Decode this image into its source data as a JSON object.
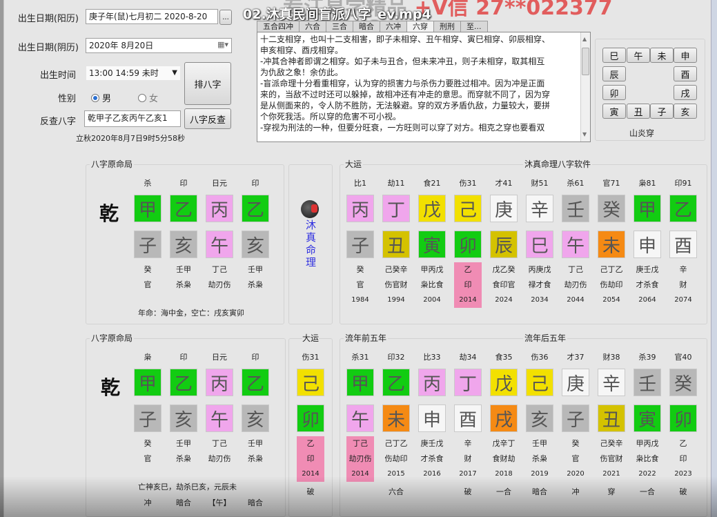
{
  "video": {
    "title": "02.沐真民间盲派八字_ev.mp4",
    "watermark_gray": "专江易学精品",
    "watermark_red": "+V信 27**022377"
  },
  "form": {
    "birth_date_solar_label": "出生日期(阳历)",
    "birth_date_solar_value": "庚子年(鼠)七月初二 2020-8-20",
    "browse_button": "...",
    "birth_date_lunar_label": "出生日期(阴历)",
    "birth_date_lunar_value": "2020年 8月20日",
    "birth_time_label": "出生时间",
    "birth_time_value": "13:00 14:59 未时",
    "gender_label": "性别",
    "gender_options": [
      "男",
      "女"
    ],
    "gender_selected": "男",
    "reverse_label": "反查八字",
    "reverse_value": "乾甲子乙亥丙午乙亥1",
    "paipan_button": "排八字",
    "reverse_button": "八字反查",
    "solar_term_note": "立秋2020年8月7日9时5分58秒"
  },
  "relation_tabs": {
    "items": [
      "五合四冲",
      "六合",
      "三合",
      "暗合",
      "六冲",
      "六穿",
      "刑刑",
      "至..."
    ],
    "active": "六穿"
  },
  "relation_text": {
    "lines": [
      "十二支相穿，也叫十二支相害，即子未相穿、丑午相穿、寅巳相穿、卯辰相穿、",
      "申亥相穿、酉戌相穿。",
      " -冲其合神者即谓之相穿。如子未与丑合，但未来冲丑，则子未相穿，取其相互",
      "为仇敌之象！余仿此。",
      " -盲派命理十分看重相穿，认为穿的损害力与杀伤力要胜过相冲。因为冲是正面",
      "来的，当敌不过时还可以躲掉，故相冲还有冲走的意思。而穿就不同了，因为穿",
      "是从侧面来的，令人防不胜防，无法躲避。穿的双方矛盾仇敌，力量较大，要拼",
      "个你死我活。所以穿的危害不可小视。",
      " -穿视为刑法的一种，但要分旺衰，一方旺则可以穿了对方。相克之穿也要看双"
    ]
  },
  "branch_panel": {
    "top": [
      "巳",
      "午",
      "未",
      "申"
    ],
    "left": [
      "辰",
      "卯"
    ],
    "right": [
      "酉",
      "戌"
    ],
    "bottom": [
      "寅",
      "丑",
      "子",
      "亥"
    ],
    "caption": "山炎穿"
  },
  "natal_chart_1": {
    "title": "八字原命局",
    "gender_char": "乾",
    "ten_gods": [
      "杀",
      "印",
      "日元",
      "印"
    ],
    "stems": [
      {
        "char": "甲",
        "color": "green"
      },
      {
        "char": "乙",
        "color": "green"
      },
      {
        "char": "丙",
        "color": "pink"
      },
      {
        "char": "乙",
        "color": "green"
      }
    ],
    "branches": [
      {
        "char": "子",
        "color": "gray"
      },
      {
        "char": "亥",
        "color": "gray"
      },
      {
        "char": "午",
        "color": "pink"
      },
      {
        "char": "亥",
        "color": "gray"
      }
    ],
    "hidden_stems": [
      "癸",
      "壬甲",
      "丁己",
      "壬甲"
    ],
    "hidden_gods": [
      "官",
      "杀枭",
      "劫刃伤",
      "杀枭"
    ],
    "footer": "年命：海中金，空亡：戌亥寅卯"
  },
  "logo": {
    "text": "沐真命理"
  },
  "dayun": {
    "title": "大运",
    "software_title": "沐真命理八字软件",
    "columns": [
      {
        "god": "比1",
        "stem": "丙",
        "stem_color": "pink",
        "branch": "子",
        "branch_color": "gray",
        "hidden": "癸",
        "hidden_god": "官",
        "year": "1984"
      },
      {
        "god": "劫11",
        "stem": "丁",
        "stem_color": "pink",
        "branch": "丑",
        "branch_color": "olive",
        "hidden": "己癸辛",
        "hidden_god": "伤官财",
        "year": "1994"
      },
      {
        "god": "食21",
        "stem": "戊",
        "stem_color": "yellow",
        "branch": "寅",
        "branch_color": "green",
        "hidden": "甲丙戊",
        "hidden_god": "枭比食",
        "year": "2004"
      },
      {
        "god": "伤31",
        "stem": "己",
        "stem_color": "yellow",
        "branch": "卯",
        "branch_color": "green",
        "hidden": "乙",
        "hidden_god": "印",
        "year": "2014",
        "current": true
      },
      {
        "god": "才41",
        "stem": "庚",
        "stem_color": "white",
        "branch": "辰",
        "branch_color": "olive",
        "hidden": "戊乙癸",
        "hidden_god": "食印官",
        "year": "2024"
      },
      {
        "god": "财51",
        "stem": "辛",
        "stem_color": "white",
        "branch": "巳",
        "branch_color": "pink",
        "hidden": "丙庚戊",
        "hidden_god": "禄才食",
        "year": "2034"
      },
      {
        "god": "杀61",
        "stem": "壬",
        "stem_color": "gray",
        "branch": "午",
        "branch_color": "pink",
        "hidden": "丁己",
        "hidden_god": "劫刃伤",
        "year": "2044"
      },
      {
        "god": "官71",
        "stem": "癸",
        "stem_color": "gray",
        "branch": "未",
        "branch_color": "orange",
        "hidden": "己丁乙",
        "hidden_god": "伤劫印",
        "year": "2054"
      },
      {
        "god": "枭81",
        "stem": "甲",
        "stem_color": "green",
        "branch": "申",
        "branch_color": "white",
        "hidden": "庚壬戊",
        "hidden_god": "才杀食",
        "year": "2064"
      },
      {
        "god": "印91",
        "stem": "乙",
        "stem_color": "green",
        "branch": "酉",
        "branch_color": "white",
        "hidden": "辛",
        "hidden_god": "财",
        "year": "2074"
      }
    ]
  },
  "natal_chart_2": {
    "title": "八字原命局",
    "gender_char": "乾",
    "ten_gods": [
      "枭",
      "印",
      "日元",
      "印"
    ],
    "stems": [
      {
        "char": "甲",
        "color": "green"
      },
      {
        "char": "乙",
        "color": "green"
      },
      {
        "char": "丙",
        "color": "pink"
      },
      {
        "char": "乙",
        "color": "green"
      }
    ],
    "branches": [
      {
        "char": "子",
        "color": "gray"
      },
      {
        "char": "亥",
        "color": "gray"
      },
      {
        "char": "午",
        "color": "pink"
      },
      {
        "char": "亥",
        "color": "gray"
      }
    ],
    "hidden_stems": [
      "癸",
      "壬甲",
      "丁己",
      "壬甲"
    ],
    "hidden_gods": [
      "官",
      "杀枭",
      "劫刃伤",
      "杀枭"
    ],
    "shensha": "亡神亥巳，劫杀巳亥，元辰未",
    "relations": [
      "冲",
      "暗合",
      "【午】",
      "暗合"
    ]
  },
  "current_dayun": {
    "title": "大运",
    "god": "伤31",
    "stem": "己",
    "stem_color": "yellow",
    "branch": "卯",
    "branch_color": "green",
    "hidden": "乙",
    "hidden_god": "印",
    "year": "2014",
    "relation": "破"
  },
  "liunian_first": {
    "title": "流年前五年",
    "columns": [
      {
        "god": "杀31",
        "stem": "甲",
        "stem_color": "green",
        "branch": "午",
        "branch_color": "pink",
        "hidden": "丁己",
        "hidden_god": "劫刃伤",
        "year": "2014",
        "current": true,
        "relation": ""
      },
      {
        "god": "印32",
        "stem": "乙",
        "stem_color": "green",
        "branch": "未",
        "branch_color": "orange",
        "hidden": "己丁乙",
        "hidden_god": "伤劫印",
        "year": "2015",
        "relation": "六合"
      },
      {
        "god": "比33",
        "stem": "丙",
        "stem_color": "pink",
        "branch": "申",
        "branch_color": "white",
        "hidden": "庚壬戊",
        "hidden_god": "才杀食",
        "year": "2016",
        "relation": ""
      },
      {
        "god": "劫34",
        "stem": "丁",
        "stem_color": "pink",
        "branch": "酉",
        "branch_color": "white",
        "hidden": "辛",
        "hidden_god": "财",
        "year": "2017",
        "relation": "破"
      },
      {
        "god": "食35",
        "stem": "戊",
        "stem_color": "yellow",
        "branch": "戌",
        "branch_color": "orange",
        "hidden": "戊辛丁",
        "hidden_god": "食财劫",
        "year": "2018",
        "relation": "一合"
      }
    ]
  },
  "liunian_second": {
    "title": "流年后五年",
    "columns": [
      {
        "god": "伤36",
        "stem": "己",
        "stem_color": "yellow",
        "branch": "亥",
        "branch_color": "gray",
        "hidden": "壬甲",
        "hidden_god": "杀枭",
        "year": "2019",
        "relation": "暗合"
      },
      {
        "god": "才37",
        "stem": "庚",
        "stem_color": "white",
        "branch": "子",
        "branch_color": "gray",
        "hidden": "癸",
        "hidden_god": "官",
        "year": "2020",
        "relation": "冲"
      },
      {
        "god": "财38",
        "stem": "辛",
        "stem_color": "white",
        "branch": "丑",
        "branch_color": "olive",
        "hidden": "己癸辛",
        "hidden_god": "伤官财",
        "year": "2021",
        "relation": "穿"
      },
      {
        "god": "杀39",
        "stem": "壬",
        "stem_color": "gray",
        "branch": "寅",
        "branch_color": "green",
        "hidden": "甲丙戊",
        "hidden_god": "枭比食",
        "year": "2022",
        "relation": "一合"
      },
      {
        "god": "官40",
        "stem": "癸",
        "stem_color": "gray",
        "branch": "卯",
        "branch_color": "green",
        "hidden": "乙",
        "hidden_god": "印",
        "year": "2023",
        "relation": "破"
      }
    ]
  },
  "colors": {
    "green": "#12cc12",
    "pink": "#f0a6ec",
    "gray": "#b8b8b8",
    "yellow": "#f2e000",
    "olive": "#d4c200",
    "white": "#f6f6f6",
    "orange": "#f58a14",
    "current_highlight": "#f08cb4",
    "logo_blue": "#3030e0"
  }
}
